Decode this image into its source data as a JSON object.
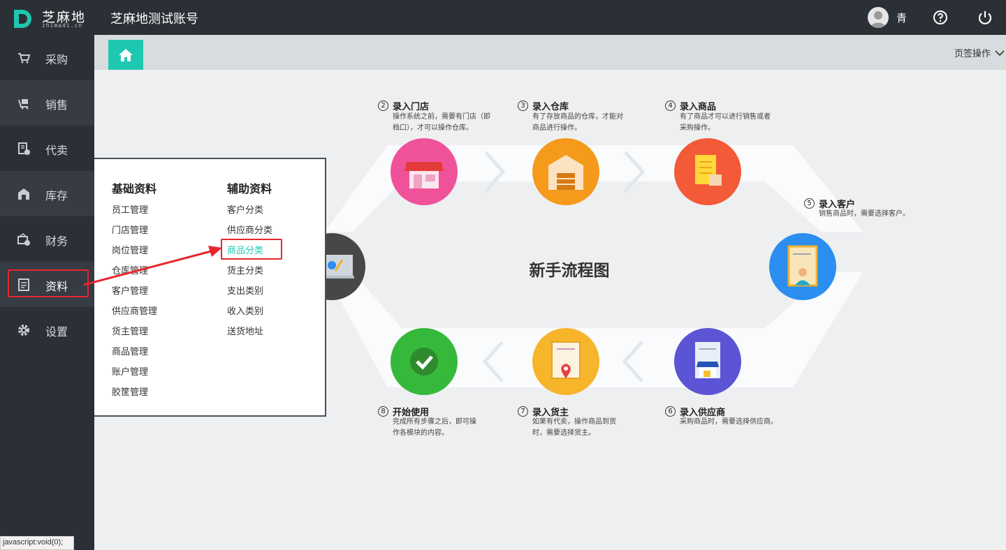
{
  "header": {
    "logo_text": "芝麻地",
    "logo_sub": "zhimadi.cn",
    "account_title": "芝麻地测试账号",
    "user_name": "青",
    "icons": [
      "avatar",
      "help-icon",
      "power-icon"
    ]
  },
  "sidebar": {
    "items": [
      {
        "label": "采购",
        "icon": "cart-icon"
      },
      {
        "label": "销售",
        "icon": "sales-cart-icon"
      },
      {
        "label": "代卖",
        "icon": "consign-icon"
      },
      {
        "label": "库存",
        "icon": "warehouse-icon"
      },
      {
        "label": "财务",
        "icon": "finance-icon"
      },
      {
        "label": "资料",
        "icon": "data-icon"
      },
      {
        "label": "设置",
        "icon": "gear-icon"
      }
    ]
  },
  "tabs": {
    "home_icon": "home-icon",
    "ops_label": "页签操作"
  },
  "menu": {
    "basic_title": "基础资料",
    "basic_items": [
      "员工管理",
      "门店管理",
      "岗位管理",
      "仓库管理",
      "客户管理",
      "供应商管理",
      "货主管理",
      "商品管理",
      "账户管理",
      "胶筐管理"
    ],
    "aux_title": "辅助资料",
    "aux_items": [
      "客户分类",
      "供应商分类",
      "商品分类",
      "货主分类",
      "支出类别",
      "收入类别",
      "送货地址"
    ],
    "active_item": "商品分类"
  },
  "flow": {
    "title": "新手流程图",
    "steps": [
      {
        "num": "2",
        "title": "录入门店",
        "desc1": "操作系统之前，需要有门店（即",
        "desc2": "档口），才可以操作仓库。"
      },
      {
        "num": "3",
        "title": "录入仓库",
        "desc1": "有了存放商品的仓库，才能对",
        "desc2": "商品进行操作。"
      },
      {
        "num": "4",
        "title": "录入商品",
        "desc1": "有了商品才可以进行销售或者",
        "desc2": "采购操作。"
      },
      {
        "num": "5",
        "title": "录入客户",
        "desc1": "销售商品时，需要选择客户。",
        "desc2": ""
      },
      {
        "num": "6",
        "title": "录入供应商",
        "desc1": "采购商品时，需要选择供应商。",
        "desc2": ""
      },
      {
        "num": "7",
        "title": "录入货主",
        "desc1": "如果有代卖，操作商品到货",
        "desc2": "时，需要选择货主。"
      },
      {
        "num": "8",
        "title": "开始使用",
        "desc1": "完成所有步骤之后，即可操",
        "desc2": "作各模块的内容。"
      }
    ],
    "colors": {
      "store": "#f0529a",
      "warehouse": "#f59a1b",
      "product": "#f35a38",
      "customer": "#2b8ef0",
      "supplier": "#5b55d6",
      "owner": "#f7b52c",
      "start": "#36b93a",
      "start_left": "#444444"
    }
  },
  "status_bar": "javascript:void(0);"
}
